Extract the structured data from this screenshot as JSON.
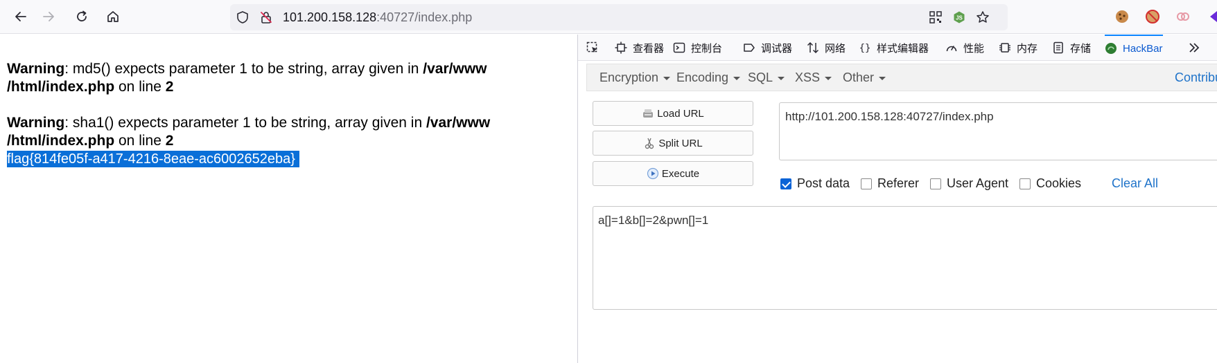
{
  "browser": {
    "url_host": "101.200.158.128",
    "url_path": ":40727/index.php"
  },
  "page": {
    "warning1": {
      "label": "Warning",
      "text": ": md5() expects parameter 1 to be string, array given in ",
      "file1": "/var/www",
      "file2": "/html/index.php",
      "line_text": " on line ",
      "line": "2"
    },
    "warning2": {
      "label": "Warning",
      "text": ": sha1() expects parameter 1 to be string, array given in ",
      "file1": "/var/www",
      "file2": "/html/index.php",
      "line_text": " on line ",
      "line": "2"
    },
    "flag": "flag{814fe05f-a417-4216-8eae-ac6002652eba}"
  },
  "devtools": {
    "tabs": {
      "inspector": "查看器",
      "console": "控制台",
      "debugger": "调试器",
      "network": "网络",
      "style_editor": "样式编辑器",
      "performance": "性能",
      "memory": "内存",
      "storage": "存储",
      "hackbar": "HackBar"
    },
    "hackbar": {
      "menu": {
        "encryption": "Encryption",
        "encoding": "Encoding",
        "sql": "SQL",
        "xss": "XSS",
        "other": "Other",
        "contribute": "Contribute"
      },
      "buttons": {
        "load_url": "Load URL",
        "split_url": "Split URL",
        "execute": "Execute"
      },
      "url_value": "http://101.200.158.128:40727/index.php",
      "options": {
        "post_data": "Post data",
        "referer": "Referer",
        "user_agent": "User Agent",
        "cookies": "Cookies",
        "clear_all": "Clear All"
      },
      "post_value": "a[]=1&b[]=2&pwn[]=1"
    }
  },
  "colors": {
    "flag_highlight": "#0a6fd8",
    "hackbar_active": "#0a59d0",
    "link_blue": "#1f73c9"
  }
}
